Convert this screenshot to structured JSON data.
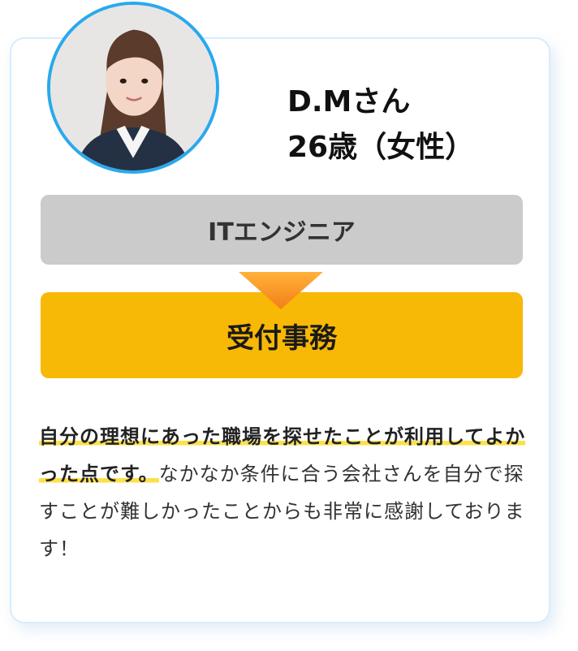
{
  "profile": {
    "name": "D.Mさん",
    "age_gender": "26歳（女性）",
    "photo_alt": "woman-portrait"
  },
  "career": {
    "before": "ITエンジニア",
    "after": "受付事務"
  },
  "testimonial": {
    "highlight": "自分の理想にあった職場を探せたことが利用してよかった点です。",
    "rest": "なかなか条件に合う会社さんを自分で探すことが難しかったことからも非常に感謝しております！"
  },
  "colors": {
    "card_border": "#d8ecfb",
    "avatar_ring": "#29a9ee",
    "before_bg": "#cbcbcb",
    "after_bg": "#f8b806",
    "arrow": "#f7941d",
    "highlight": "#fde04a"
  }
}
